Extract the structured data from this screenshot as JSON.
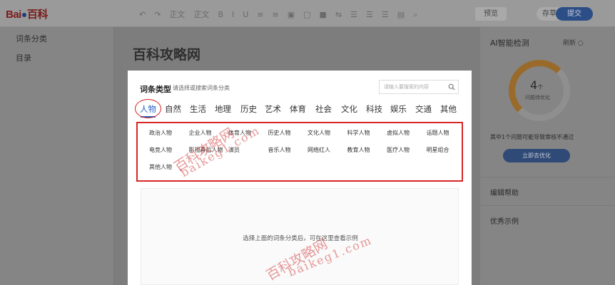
{
  "header": {
    "logo": "Bai\u0007百科",
    "logo_prefix": "Bai",
    "logo_paw": "🐾",
    "logo_suffix": "百科",
    "toolbar_items": [
      "↶",
      "↷",
      "正文",
      "正文",
      "B",
      "I",
      "U",
      "≡",
      "≡",
      "▣",
      "□",
      "■",
      "⇆",
      "☰",
      "☰",
      "☰",
      "▤",
      "⌕"
    ],
    "preview_label": "预览",
    "save_label": "存草稿",
    "submit_label": "提交"
  },
  "sidebar": {
    "items": [
      {
        "label": "词条分类"
      },
      {
        "label": "目录"
      }
    ]
  },
  "main": {
    "page_title": "百科攻略网"
  },
  "right_panel": {
    "ai_title": "AI智能检测",
    "refresh_label": "刷新 ○",
    "issue_count": "4",
    "issue_unit": "个",
    "issue_sub": "问题待优化",
    "issue_progress": 0.25,
    "note": "其中1个问题可能导致审核不通过",
    "optimize_button": "立即去优化",
    "edit_help": "编辑帮助",
    "good_examples": "优秀示例"
  },
  "modal": {
    "title": "词条类型",
    "subtitle": "请选择或搜索词条分类",
    "search_placeholder": "请输入要搜索的内容",
    "tabs": [
      {
        "label": "人物",
        "active": true
      },
      {
        "label": "自然"
      },
      {
        "label": "生活"
      },
      {
        "label": "地理"
      },
      {
        "label": "历史"
      },
      {
        "label": "艺术"
      },
      {
        "label": "体育"
      },
      {
        "label": "社会"
      },
      {
        "label": "文化"
      },
      {
        "label": "科技"
      },
      {
        "label": "娱乐"
      },
      {
        "label": "交通"
      },
      {
        "label": "其他"
      }
    ],
    "subcategories": [
      "政治人物",
      "企业人物",
      "体育人物",
      "历史人物",
      "文化人物",
      "科学人物",
      "虚拟人物",
      "话题人物",
      "电竞人物",
      "影视幕后人物",
      "演员",
      "音乐人物",
      "网络红人",
      "教育人物",
      "医疗人物",
      "明星组合",
      "其他人物"
    ],
    "example_hint": "选择上面的词条分类后，可在这里查看示例"
  },
  "watermarks": [
    "百科攻略网",
    "baikeg1.com",
    "百科攻略网",
    "baikeg1.com"
  ],
  "colors": {
    "accent_blue": "#2a64c8",
    "highlight_red": "#d92626",
    "overlay_gray": "#7d7d7d"
  }
}
